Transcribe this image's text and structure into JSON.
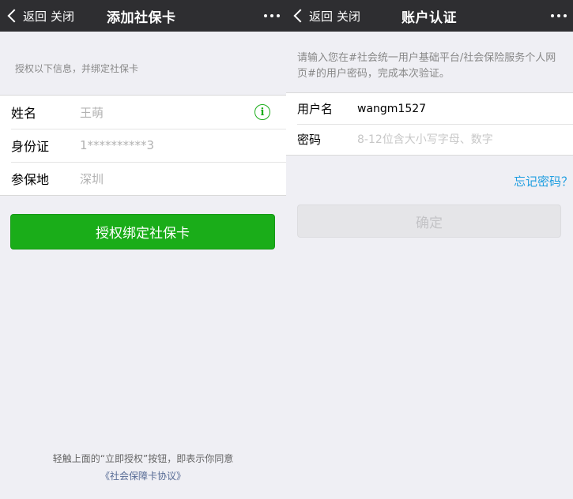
{
  "left": {
    "nav": {
      "back_label": "返回",
      "close_label": "关闭",
      "title": "添加社保卡"
    },
    "hint": "授权以下信息，并绑定社保卡",
    "fields": [
      {
        "label": "姓名",
        "value": "王萌"
      },
      {
        "label": "身份证",
        "value": "1**********3"
      },
      {
        "label": "参保地",
        "value": "深圳"
      }
    ],
    "info_icon": "i",
    "bind_button": "授权绑定社保卡",
    "footer": {
      "line1": "轻触上面的“立即授权”按钮，即表示你同意",
      "link": "《社会保障卡协议》"
    }
  },
  "right": {
    "nav": {
      "back_label": "返回",
      "close_label": "关闭",
      "title": "账户认证"
    },
    "hint": "请输入您在#社会统一用户基础平台/社会保险服务个人网页#的用户密码，完成本次验证。",
    "username": {
      "label": "用户名",
      "value": "wangm1527"
    },
    "password": {
      "label": "密码",
      "placeholder": "8-12位含大小写字母、数字"
    },
    "forgot_link": "忘记密码？",
    "confirm_button": "确定"
  },
  "colors": {
    "nav_bg": "#2e2e31",
    "primary_green": "#1aad19",
    "link_blue": "#1f9ee0",
    "footer_link": "#576b95",
    "page_bg": "#efeff4"
  }
}
